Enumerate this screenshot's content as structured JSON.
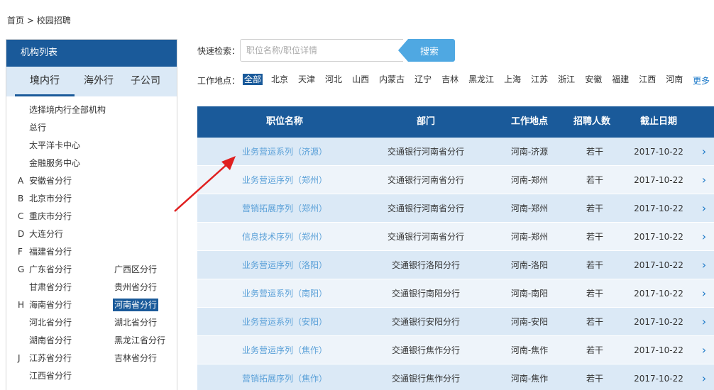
{
  "breadcrumb": {
    "home": "首页",
    "sep": ">",
    "current": "校园招聘"
  },
  "sidebar": {
    "title": "机构列表",
    "tabs": {
      "domestic": "境内行",
      "overseas": "海外行",
      "subsidiary": "子公司"
    },
    "items": [
      {
        "letter": "",
        "left": "选择境内行全部机构",
        "right": ""
      },
      {
        "letter": "",
        "left": "总行",
        "right": ""
      },
      {
        "letter": "",
        "left": "太平洋卡中心",
        "right": ""
      },
      {
        "letter": "",
        "left": "金融服务中心",
        "right": ""
      },
      {
        "letter": "A",
        "left": "安徽省分行",
        "right": ""
      },
      {
        "letter": "B",
        "left": "北京市分行",
        "right": ""
      },
      {
        "letter": "C",
        "left": "重庆市分行",
        "right": ""
      },
      {
        "letter": "D",
        "left": "大连分行",
        "right": ""
      },
      {
        "letter": "F",
        "left": "福建省分行",
        "right": ""
      },
      {
        "letter": "G",
        "left": "广东省分行",
        "right": "广西区分行"
      },
      {
        "letter": "",
        "left": "甘肃省分行",
        "right": "贵州省分行"
      },
      {
        "letter": "H",
        "left": "海南省分行",
        "right": "河南省分行"
      },
      {
        "letter": "",
        "left": "河北省分行",
        "right": "湖北省分行"
      },
      {
        "letter": "",
        "left": "湖南省分行",
        "right": "黑龙江省分行"
      },
      {
        "letter": "J",
        "left": "江苏省分行",
        "right": "吉林省分行"
      },
      {
        "letter": "",
        "left": "江西省分行",
        "right": ""
      }
    ]
  },
  "search": {
    "label": "快速检索：",
    "placeholder": "职位名称/职位详情",
    "button": "搜索"
  },
  "location": {
    "label": "工作地点：",
    "options": [
      "全部",
      "北京",
      "天津",
      "河北",
      "山西",
      "内蒙古",
      "辽宁",
      "吉林",
      "黑龙江",
      "上海",
      "江苏",
      "浙江",
      "安徽",
      "福建",
      "江西",
      "河南"
    ],
    "more": "更多"
  },
  "table": {
    "headers": {
      "name": "职位名称",
      "dept": "部门",
      "loc": "工作地点",
      "num": "招聘人数",
      "date": "截止日期"
    },
    "rows": [
      {
        "name": "业务营运系列（济源）",
        "dept": "交通银行河南省分行",
        "loc": "河南-济源",
        "num": "若干",
        "date": "2017-10-22"
      },
      {
        "name": "业务营运序列（郑州）",
        "dept": "交通银行河南省分行",
        "loc": "河南-郑州",
        "num": "若干",
        "date": "2017-10-22"
      },
      {
        "name": "营销拓展序列（郑州）",
        "dept": "交通银行河南省分行",
        "loc": "河南-郑州",
        "num": "若干",
        "date": "2017-10-22"
      },
      {
        "name": "信息技术序列（郑州）",
        "dept": "交通银行河南省分行",
        "loc": "河南-郑州",
        "num": "若干",
        "date": "2017-10-22"
      },
      {
        "name": "业务营运序列（洛阳）",
        "dept": "交通银行洛阳分行",
        "loc": "河南-洛阳",
        "num": "若干",
        "date": "2017-10-22"
      },
      {
        "name": "业务营运系列（南阳）",
        "dept": "交通银行南阳分行",
        "loc": "河南-南阳",
        "num": "若干",
        "date": "2017-10-22"
      },
      {
        "name": "业务营运系列（安阳）",
        "dept": "交通银行安阳分行",
        "loc": "河南-安阳",
        "num": "若干",
        "date": "2017-10-22"
      },
      {
        "name": "业务营运序列（焦作）",
        "dept": "交通银行焦作分行",
        "loc": "河南-焦作",
        "num": "若干",
        "date": "2017-10-22"
      },
      {
        "name": "营销拓展序列（焦作）",
        "dept": "交通银行焦作分行",
        "loc": "河南-焦作",
        "num": "若干",
        "date": "2017-10-22"
      }
    ]
  },
  "icons": {
    "row_arrow": "chevron-right-icon",
    "annotation": "red-arrow-icon"
  },
  "colors": {
    "primary": "#1a5a9a",
    "accent": "#4fa8e2",
    "row_light": "#dbe9f6",
    "link": "#5aa0d8",
    "annotation": "#e02020"
  }
}
